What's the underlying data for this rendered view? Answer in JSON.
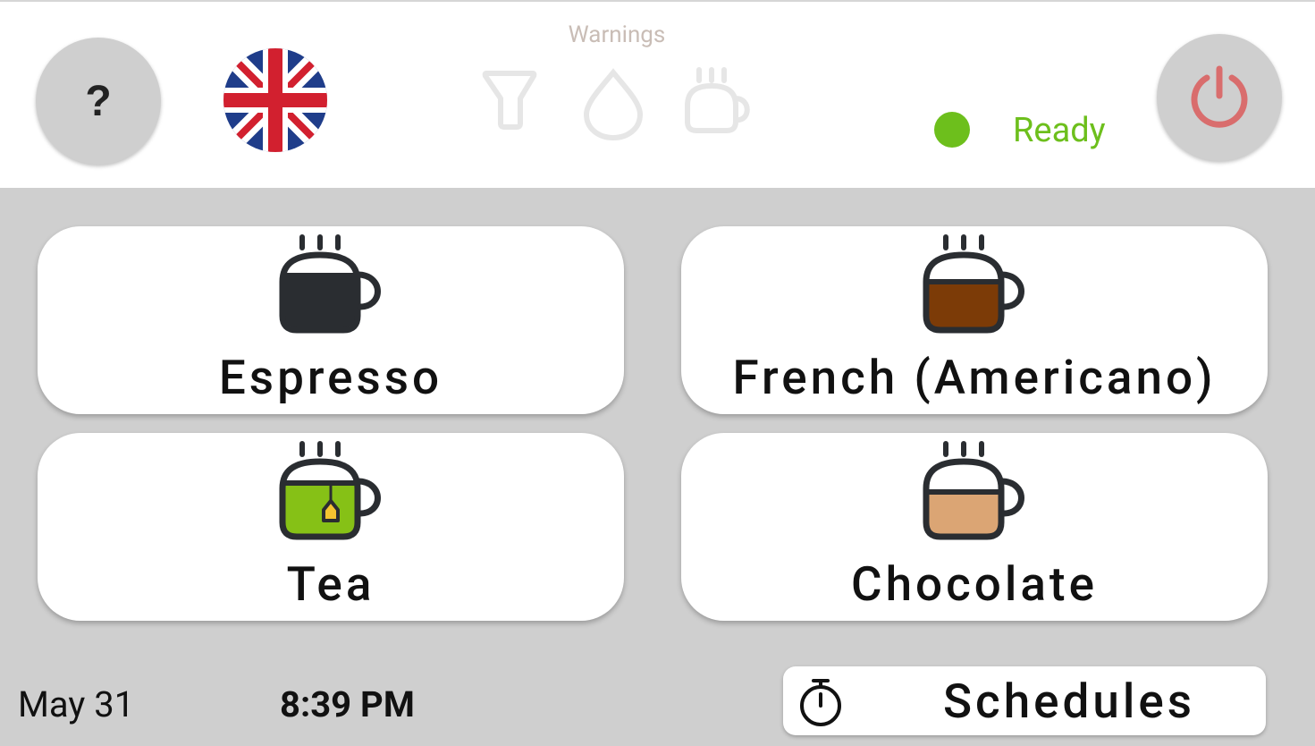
{
  "header": {
    "help_label": "?",
    "language": "English (UK)",
    "warnings_label": "Warnings",
    "warning_icons": [
      "filter-icon",
      "water-drop-icon",
      "cup-icon"
    ],
    "status_text": "Ready",
    "status_color": "#6dbf1c",
    "power_icon_color": "#d96d6d"
  },
  "drinks": [
    {
      "label": "Espresso",
      "icon": "espresso-cup-icon",
      "fill_color": "#2a2d31"
    },
    {
      "label": "French (Americano)",
      "icon": "americano-cup-icon",
      "fill_color": "#7c3b07"
    },
    {
      "label": "Tea",
      "icon": "tea-cup-icon",
      "fill_color": "#86c116"
    },
    {
      "label": "Chocolate",
      "icon": "chocolate-cup-icon",
      "fill_color": "#dba574"
    }
  ],
  "footer": {
    "date": "May 31",
    "time": "8:39 PM",
    "schedules_label": "Schedules"
  }
}
